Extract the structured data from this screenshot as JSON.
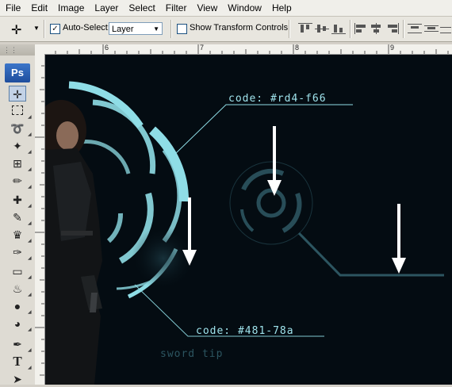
{
  "menu": [
    "File",
    "Edit",
    "Image",
    "Layer",
    "Select",
    "Filter",
    "View",
    "Window",
    "Help"
  ],
  "options": {
    "auto_select_label": "Auto-Select:",
    "layer_select_value": "Layer",
    "show_transform_label": "Show Transform Controls"
  },
  "toolbox": {
    "logo": "Ps",
    "tools": [
      "move-tool",
      "marquee-tool",
      "lasso-tool",
      "magic-wand-tool",
      "crop-tool",
      "eyedropper-tool",
      "healing-brush-tool",
      "brush-tool",
      "clone-stamp-tool",
      "history-brush-tool",
      "eraser-tool",
      "paint-bucket-tool",
      "blur-tool",
      "dodge-tool",
      "pen-tool",
      "type-tool",
      "path-selection-tool"
    ]
  },
  "ruler": {
    "top_numbers": [
      "6",
      "7",
      "8",
      "9"
    ]
  },
  "canvas": {
    "code_top": "code: #rd4-f66",
    "code_bottom": "code: #481-78a",
    "sword_tip": "sword tip"
  },
  "colors": {
    "accent": "#8fdde6",
    "canvas_bg": "#040c12"
  }
}
